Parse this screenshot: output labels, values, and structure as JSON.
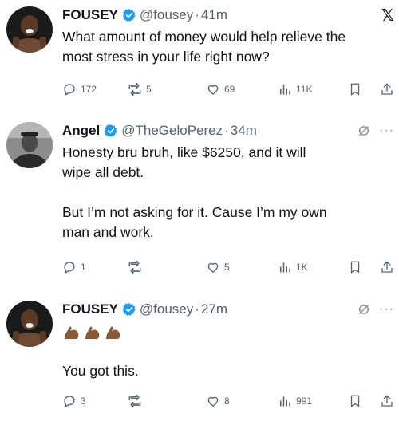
{
  "tweets": [
    {
      "name": "FOUSEY",
      "handle": "@fousey",
      "time": "41m",
      "lines": [
        "What amount of money would help relieve the",
        "most stress in your life right now?"
      ],
      "replies": "172",
      "reposts": "5",
      "likes": "69",
      "views": "11K",
      "corner_icon": "x-logo-icon"
    },
    {
      "name": "Angel",
      "handle": "@TheGeloPerez",
      "time": "34m",
      "paragraphs": [
        [
          "Honesty bru bruh, like $6250, and it will",
          "wipe all debt."
        ],
        [
          "But I’m not asking for it. Cause I’m my own",
          "man and work."
        ]
      ],
      "replies": "1",
      "reposts": "",
      "likes": "5",
      "views": "1K"
    },
    {
      "name": "FOUSEY",
      "handle": "@fousey",
      "time": "27m",
      "emojis": [
        "flexed-biceps-icon",
        "flexed-biceps-icon",
        "flexed-biceps-icon"
      ],
      "lines": [
        "You got this."
      ],
      "replies": "3",
      "reposts": "",
      "likes": "8",
      "views": "991"
    }
  ],
  "x_logo": "𝕏",
  "more": "···",
  "sep": "·",
  "colors": {
    "verified": "#1d9bf0",
    "secondary": "#536471",
    "text": "#0f1419",
    "emoji_skin": "#8a5a35"
  }
}
